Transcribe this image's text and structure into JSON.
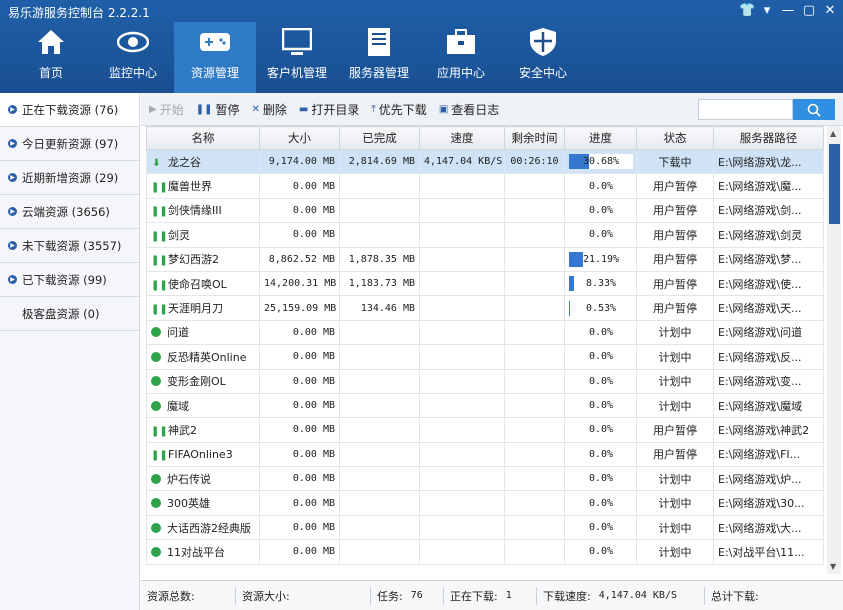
{
  "app": {
    "title": "易乐游服务控制台 2.2.2.1"
  },
  "nav": [
    {
      "label": "首页",
      "icon": "home-icon"
    },
    {
      "label": "监控中心",
      "icon": "eye-icon"
    },
    {
      "label": "资源管理",
      "icon": "gamepad-icon",
      "active": true
    },
    {
      "label": "客户机管理",
      "icon": "monitor-icon"
    },
    {
      "label": "服务器管理",
      "icon": "server-icon"
    },
    {
      "label": "应用中心",
      "icon": "toolbox-icon"
    },
    {
      "label": "安全中心",
      "icon": "shield-icon"
    }
  ],
  "sidebar": [
    {
      "label": "正在下载资源 (76)",
      "active": true
    },
    {
      "label": "今日更新资源 (97)"
    },
    {
      "label": "近期新增资源 (29)"
    },
    {
      "label": "云端资源 (3656)"
    },
    {
      "label": "未下载资源 (3557)"
    },
    {
      "label": "已下载资源 (99)"
    },
    {
      "label": "极客盘资源 (0)",
      "nodot": true
    }
  ],
  "toolbar": {
    "start": "开始",
    "pause": "暂停",
    "delete": "删除",
    "open_dir": "打开目录",
    "priority": "优先下载",
    "log": "查看日志"
  },
  "table": {
    "columns": [
      "名称",
      "大小",
      "已完成",
      "速度",
      "剩余时间",
      "进度",
      "状态",
      "服务器路径"
    ],
    "rows": [
      {
        "icon": "download",
        "name": "龙之谷",
        "size": "9,174.00 MB",
        "done": "2,814.69 MB",
        "speed": "4,147.04 KB/S",
        "remain": "00:26:10",
        "progress": "30.68%",
        "pct": 30.68,
        "status": "下载中",
        "path": "E:\\网络游戏\\龙..."
      },
      {
        "icon": "pause",
        "name": "魔兽世界",
        "size": "0.00 MB",
        "done": "",
        "speed": "",
        "remain": "",
        "progress": "0.0%",
        "pct": 0,
        "status": "用户暂停",
        "path": "E:\\网络游戏\\魔..."
      },
      {
        "icon": "pause",
        "name": "剑侠情缘III",
        "size": "0.00 MB",
        "done": "",
        "speed": "",
        "remain": "",
        "progress": "0.0%",
        "pct": 0,
        "status": "用户暂停",
        "path": "E:\\网络游戏\\剑..."
      },
      {
        "icon": "pause",
        "name": "剑灵",
        "size": "0.00 MB",
        "done": "",
        "speed": "",
        "remain": "",
        "progress": "0.0%",
        "pct": 0,
        "status": "用户暂停",
        "path": "E:\\网络游戏\\剑灵"
      },
      {
        "icon": "pause",
        "name": "梦幻西游2",
        "size": "8,862.52 MB",
        "done": "1,878.35 MB",
        "speed": "",
        "remain": "",
        "progress": "21.19%",
        "pct": 21.19,
        "status": "用户暂停",
        "path": "E:\\网络游戏\\梦..."
      },
      {
        "icon": "pause",
        "name": "使命召唤OL",
        "size": "14,200.31 MB",
        "done": "1,183.73 MB",
        "speed": "",
        "remain": "",
        "progress": "8.33%",
        "pct": 8.33,
        "status": "用户暂停",
        "path": "E:\\网络游戏\\使..."
      },
      {
        "icon": "pause",
        "name": "天涯明月刀",
        "size": "25,159.09 MB",
        "done": "134.46 MB",
        "speed": "",
        "remain": "",
        "progress": "0.53%",
        "pct": 0.53,
        "status": "用户暂停",
        "path": "E:\\网络游戏\\天..."
      },
      {
        "icon": "clock",
        "name": "问道",
        "size": "0.00 MB",
        "done": "",
        "speed": "",
        "remain": "",
        "progress": "0.0%",
        "pct": 0,
        "status": "计划中",
        "path": "E:\\网络游戏\\问道"
      },
      {
        "icon": "clock",
        "name": "反恐精英Online",
        "size": "0.00 MB",
        "done": "",
        "speed": "",
        "remain": "",
        "progress": "0.0%",
        "pct": 0,
        "status": "计划中",
        "path": "E:\\网络游戏\\反..."
      },
      {
        "icon": "clock",
        "name": "变形金刚OL",
        "size": "0.00 MB",
        "done": "",
        "speed": "",
        "remain": "",
        "progress": "0.0%",
        "pct": 0,
        "status": "计划中",
        "path": "E:\\网络游戏\\变..."
      },
      {
        "icon": "clock",
        "name": "魔域",
        "size": "0.00 MB",
        "done": "",
        "speed": "",
        "remain": "",
        "progress": "0.0%",
        "pct": 0,
        "status": "计划中",
        "path": "E:\\网络游戏\\魔域"
      },
      {
        "icon": "pause",
        "name": "神武2",
        "size": "0.00 MB",
        "done": "",
        "speed": "",
        "remain": "",
        "progress": "0.0%",
        "pct": 0,
        "status": "用户暂停",
        "path": "E:\\网络游戏\\神武2"
      },
      {
        "icon": "pause",
        "name": "FIFAOnline3",
        "size": "0.00 MB",
        "done": "",
        "speed": "",
        "remain": "",
        "progress": "0.0%",
        "pct": 0,
        "status": "用户暂停",
        "path": "E:\\网络游戏\\FI..."
      },
      {
        "icon": "clock",
        "name": "炉石传说",
        "size": "0.00 MB",
        "done": "",
        "speed": "",
        "remain": "",
        "progress": "0.0%",
        "pct": 0,
        "status": "计划中",
        "path": "E:\\网络游戏\\炉..."
      },
      {
        "icon": "clock",
        "name": "300英雄",
        "size": "0.00 MB",
        "done": "",
        "speed": "",
        "remain": "",
        "progress": "0.0%",
        "pct": 0,
        "status": "计划中",
        "path": "E:\\网络游戏\\30..."
      },
      {
        "icon": "clock",
        "name": "大话西游2经典版",
        "size": "0.00 MB",
        "done": "",
        "speed": "",
        "remain": "",
        "progress": "0.0%",
        "pct": 0,
        "status": "计划中",
        "path": "E:\\网络游戏\\大..."
      },
      {
        "icon": "clock",
        "name": "11对战平台",
        "size": "0.00 MB",
        "done": "",
        "speed": "",
        "remain": "",
        "progress": "0.0%",
        "pct": 0,
        "status": "计划中",
        "path": "E:\\对战平台\\11..."
      }
    ]
  },
  "statusbar": {
    "total_label": "资源总数:",
    "size_label": "资源大小:",
    "tasks_label": "任务:",
    "tasks_value": "76",
    "downloading_label": "正在下载:",
    "downloading_value": "1",
    "speed_label": "下载速度:",
    "speed_value": "4,147.04 KB/S",
    "total_dl_label": "总计下载:"
  }
}
